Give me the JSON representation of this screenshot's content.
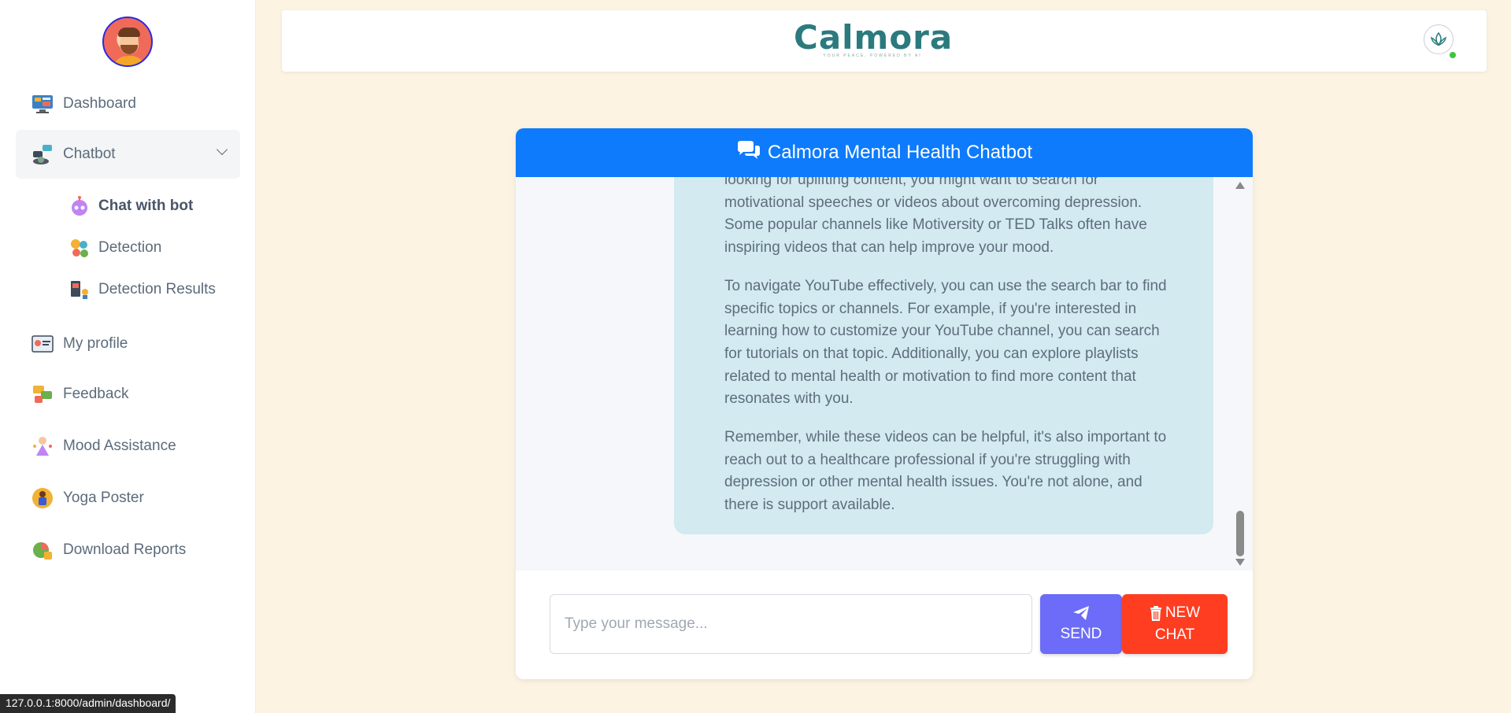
{
  "sidebar": {
    "items": [
      {
        "label": "Dashboard",
        "icon": "dashboard-icon"
      },
      {
        "label": "Chatbot",
        "icon": "chatbot-icon"
      },
      {
        "label": "My profile",
        "icon": "profile-icon"
      },
      {
        "label": "Feedback",
        "icon": "feedback-icon"
      },
      {
        "label": "Mood Assistance",
        "icon": "mood-icon"
      },
      {
        "label": "Yoga Poster",
        "icon": "yoga-icon"
      },
      {
        "label": "Download Reports",
        "icon": "reports-icon"
      }
    ],
    "subitems": [
      {
        "label": "Chat with bot",
        "icon": "robot-icon"
      },
      {
        "label": "Detection",
        "icon": "detection-icon"
      },
      {
        "label": "Detection Results",
        "icon": "results-icon"
      }
    ]
  },
  "header": {
    "brand": "Calmora",
    "tagline": "YOUR PEACE, POWERED BY AI"
  },
  "chat": {
    "title": "Calmora Mental Health Chatbot",
    "messages": [
      "looking for uplifting content, you might want to search for motivational speeches or videos about overcoming depression. Some popular channels like Motiversity or TED Talks often have inspiring videos that can help improve your mood.",
      "To navigate YouTube effectively, you can use the search bar to find specific topics or channels. For example, if you're interested in learning how to customize your YouTube channel, you can search for tutorials on that topic. Additionally, you can explore playlists related to mental health or motivation to find more content that resonates with you.",
      "Remember, while these videos can be helpful, it's also important to reach out to a healthcare professional if you're struggling with depression or other mental health issues. You're not alone, and there is support available."
    ],
    "input_placeholder": "Type your message...",
    "send_label": "SEND",
    "new_chat_line1": "NEW",
    "new_chat_line2": "CHAT"
  },
  "status_bar": {
    "url": "127.0.0.1:8000/admin/dashboard/"
  },
  "colors": {
    "primary": "#0d7bfb",
    "send": "#6c6cf8",
    "new_chat": "#ff3d21",
    "brand": "#2b7a7e",
    "bot_bubble": "#d2eaf0",
    "page_bg": "#fdf3e3"
  }
}
